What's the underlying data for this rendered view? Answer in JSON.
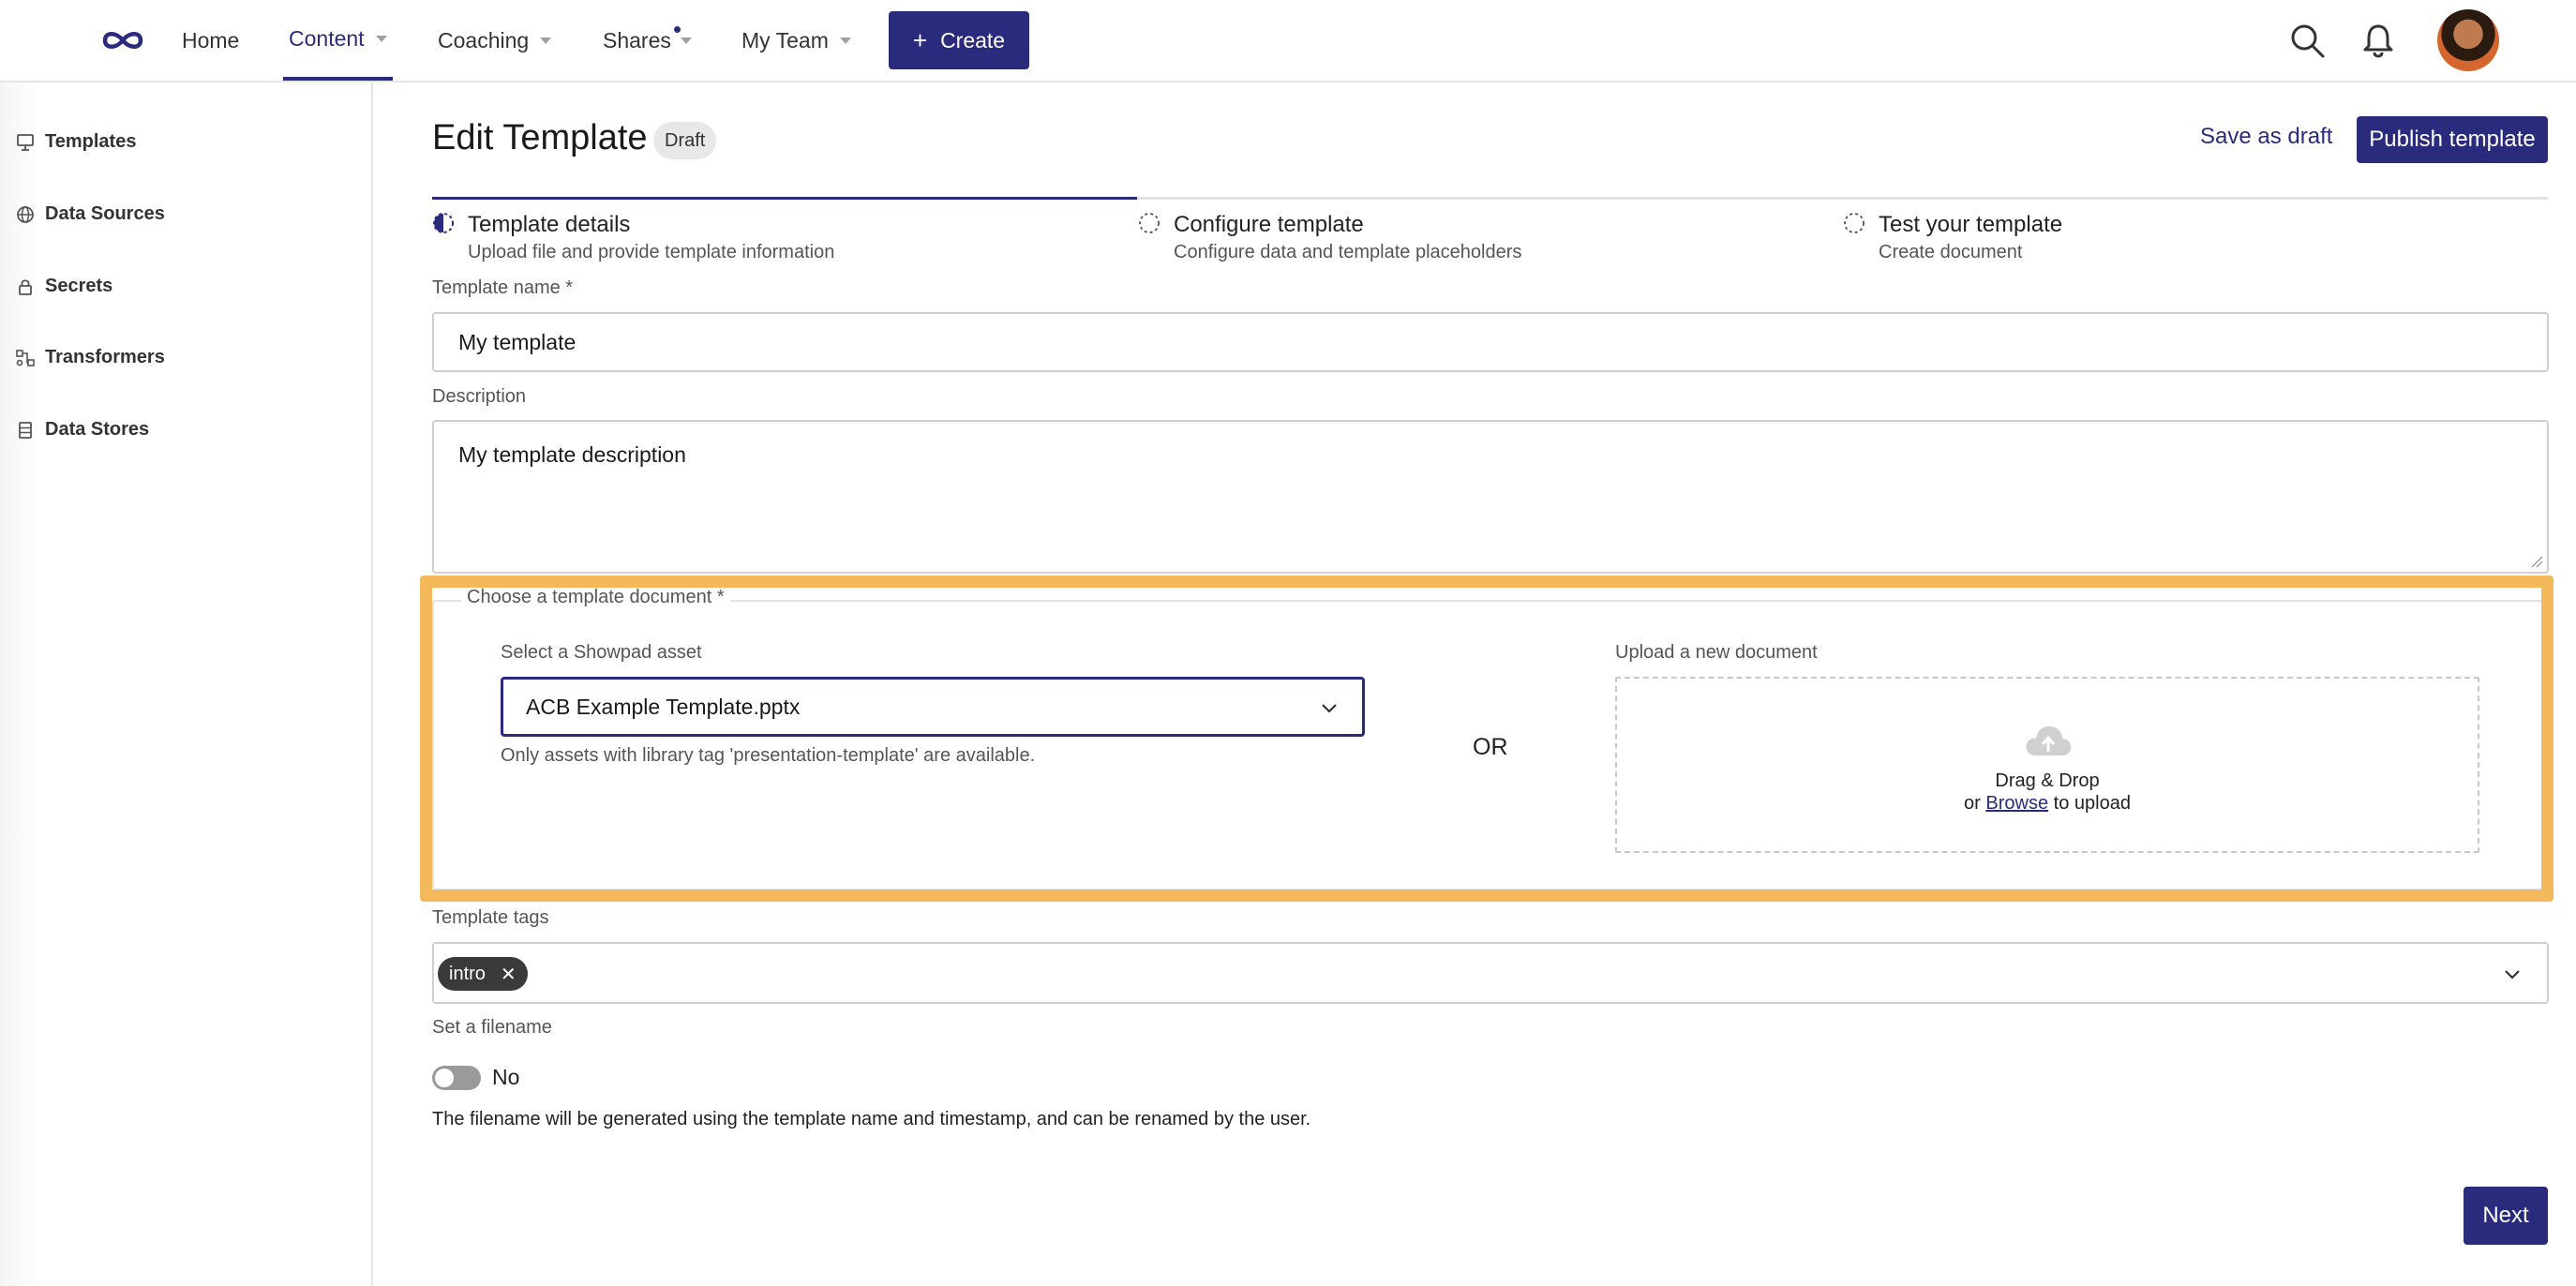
{
  "nav": {
    "items": [
      {
        "label": "Home"
      },
      {
        "label": "Content"
      },
      {
        "label": "Coaching"
      },
      {
        "label": "Shares"
      },
      {
        "label": "My Team"
      }
    ],
    "create_label": "Create",
    "active": "Content",
    "accent_color": "#2b2b7e"
  },
  "sidebar": {
    "items": [
      {
        "label": "Templates",
        "icon": "presentation-icon"
      },
      {
        "label": "Data Sources",
        "icon": "globe-icon"
      },
      {
        "label": "Secrets",
        "icon": "lock-icon"
      },
      {
        "label": "Transformers",
        "icon": "flow-icon"
      },
      {
        "label": "Data Stores",
        "icon": "database-icon"
      }
    ]
  },
  "header": {
    "title": "Edit Template",
    "badge": "Draft",
    "save_draft": "Save as draft",
    "publish": "Publish template"
  },
  "steps": [
    {
      "title": "Template details",
      "subtitle": "Upload file and provide template information",
      "state": "in-progress"
    },
    {
      "title": "Configure template",
      "subtitle": "Configure data and template placeholders",
      "state": "pending"
    },
    {
      "title": "Test your template",
      "subtitle": "Create document",
      "state": "pending"
    }
  ],
  "form": {
    "name_label": "Template name *",
    "name_value": "My template",
    "description_label": "Description",
    "description_value": "My template description",
    "document_legend": "Choose a template document *",
    "asset_label": "Select a Showpad asset",
    "asset_value": "ACB Example Template.pptx",
    "asset_helper": "Only assets with library tag 'presentation-template' are available.",
    "or_text": "OR",
    "upload_label": "Upload a new document",
    "dropzone_line1": "Drag & Drop",
    "dropzone_or": "or",
    "dropzone_browse": "Browse",
    "dropzone_suffix": "to upload",
    "tags_label": "Template tags",
    "tags": [
      "intro"
    ],
    "filename_label": "Set a filename",
    "filename_toggle": "No",
    "filename_helper": "The filename will be generated using the template name and timestamp, and can be renamed by the user.",
    "next": "Next"
  },
  "highlight_color": "#f4b95a"
}
